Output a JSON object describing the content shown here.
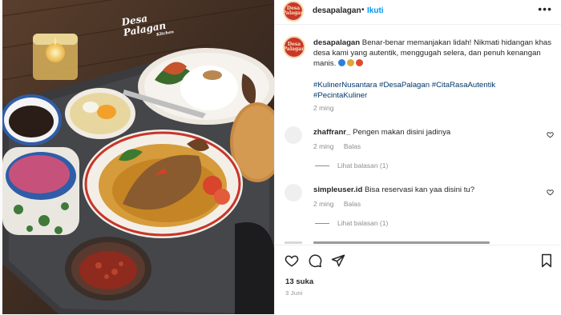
{
  "post": {
    "watermark_line1": "Desa",
    "watermark_line2": "Palagan",
    "watermark_line3": "Kitchen"
  },
  "header": {
    "avatar_line1": "Desa",
    "avatar_line2": "Palagan",
    "username": "desapalagan",
    "separator": "•",
    "follow_label": "Ikuti",
    "more_icon": "more-dots-icon"
  },
  "caption": {
    "username": "desapalagan",
    "text": "Benar-benar memanjakan lidah! Nikmati hidangan khas desa kami yang autentik, menggugah selera, dan penuh kenangan manis.",
    "emoji_colors": [
      "#2f7fd8",
      "#e0a63c",
      "#e04a2c"
    ],
    "hashtags": "#KulinerNusantara #DesaPalagan #CitaRasaAutentik #PecintaKuliner",
    "time": "2 ming"
  },
  "comments": [
    {
      "username": "zhaffranr_",
      "text": "Pengen makan disini jadinya",
      "time": "2 ming",
      "reply_label": "Balas",
      "view_replies": "Lihat balasan (1)"
    },
    {
      "username": "simpleuser.id",
      "text": "Bisa reservasi kan yaa disini tu?",
      "time": "2 ming",
      "reply_label": "Balas",
      "view_replies": "Lihat balasan (1)"
    }
  ],
  "actions": {
    "like_icon": "heart-icon",
    "comment_icon": "comment-icon",
    "share_icon": "send-icon",
    "save_icon": "bookmark-icon"
  },
  "likes": "13 suka",
  "date": "3 Juni",
  "colors": {
    "link": "#0095f6",
    "hashtag": "#00376b",
    "muted": "#8e8e8e",
    "brand": "#c9372c"
  }
}
